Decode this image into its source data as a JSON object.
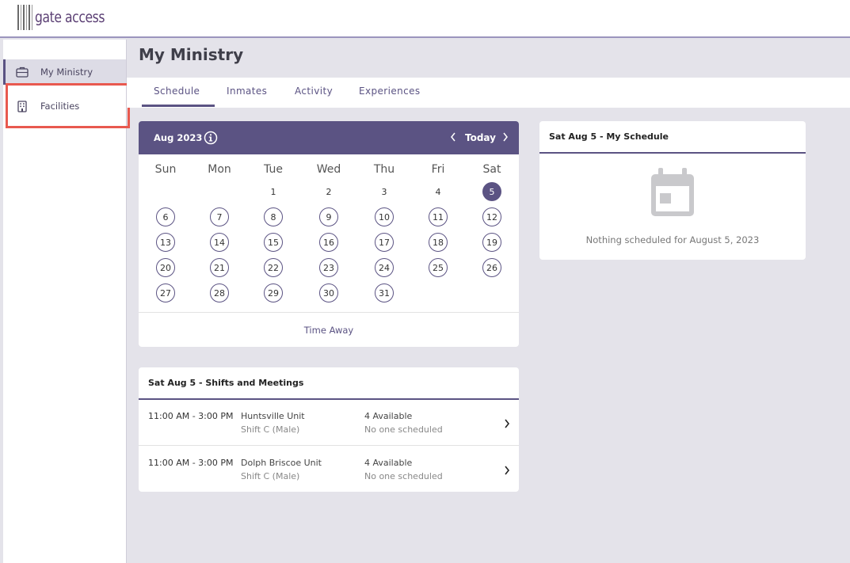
{
  "app": {
    "logo_text": "gate access"
  },
  "sidebar": {
    "items": [
      {
        "label": "My Ministry",
        "icon": "briefcase-icon",
        "active": true
      },
      {
        "label": "Facilities",
        "icon": "building-icon",
        "active": false
      }
    ]
  },
  "page": {
    "title": "My Ministry"
  },
  "tabs": [
    {
      "label": "Schedule",
      "active": true
    },
    {
      "label": "Inmates",
      "active": false
    },
    {
      "label": "Activity",
      "active": false
    },
    {
      "label": "Experiences",
      "active": false
    }
  ],
  "calendar": {
    "month_label": "Aug 2023",
    "today_label": "Today",
    "weekdays": [
      "Sun",
      "Mon",
      "Tue",
      "Wed",
      "Thu",
      "Fri",
      "Sat"
    ],
    "first_weekday_index": 2,
    "days_in_month": 31,
    "selected_day": 5,
    "footer_label": "Time Away"
  },
  "my_schedule": {
    "title": "Sat Aug 5 - My Schedule",
    "empty_text": "Nothing scheduled for August 5, 2023"
  },
  "shifts": {
    "title": "Sat Aug 5 - Shifts and Meetings",
    "rows": [
      {
        "time": "11:00 AM - 3:00 PM",
        "unit": "Huntsville Unit",
        "shift": "Shift C (Male)",
        "available": "4 Available",
        "scheduled": "No one scheduled"
      },
      {
        "time": "11:00 AM - 3:00 PM",
        "unit": "Dolph Briscoe Unit",
        "shift": "Shift C (Male)",
        "available": "4 Available",
        "scheduled": "No one scheduled"
      }
    ]
  },
  "colors": {
    "accent": "#5b5383",
    "highlight": "#e8594f",
    "background": "#e4e3ea"
  }
}
